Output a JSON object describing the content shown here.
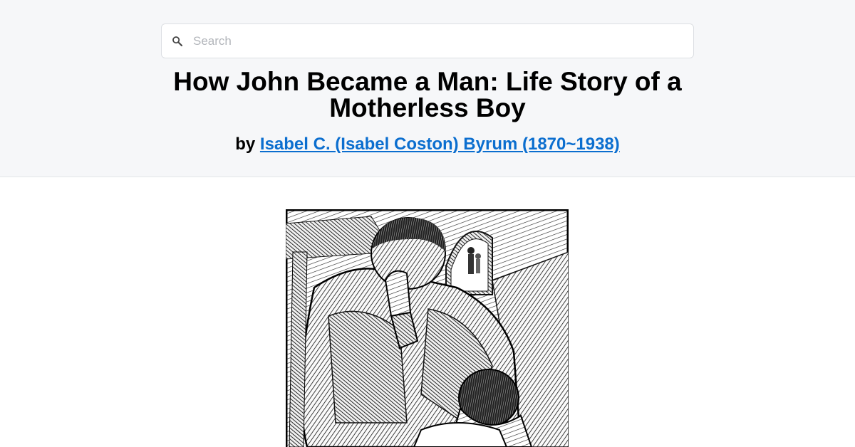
{
  "search": {
    "placeholder": "Search",
    "icon": "search-icon"
  },
  "book": {
    "title": "How John Became a Man: Life Story of a Motherless Boy",
    "by_label": "by",
    "author": "Isabel C. (Isabel Coston) Byrum (1870~1938)"
  },
  "colors": {
    "header_bg": "#f6f7f9",
    "link": "#0b6ecf"
  }
}
